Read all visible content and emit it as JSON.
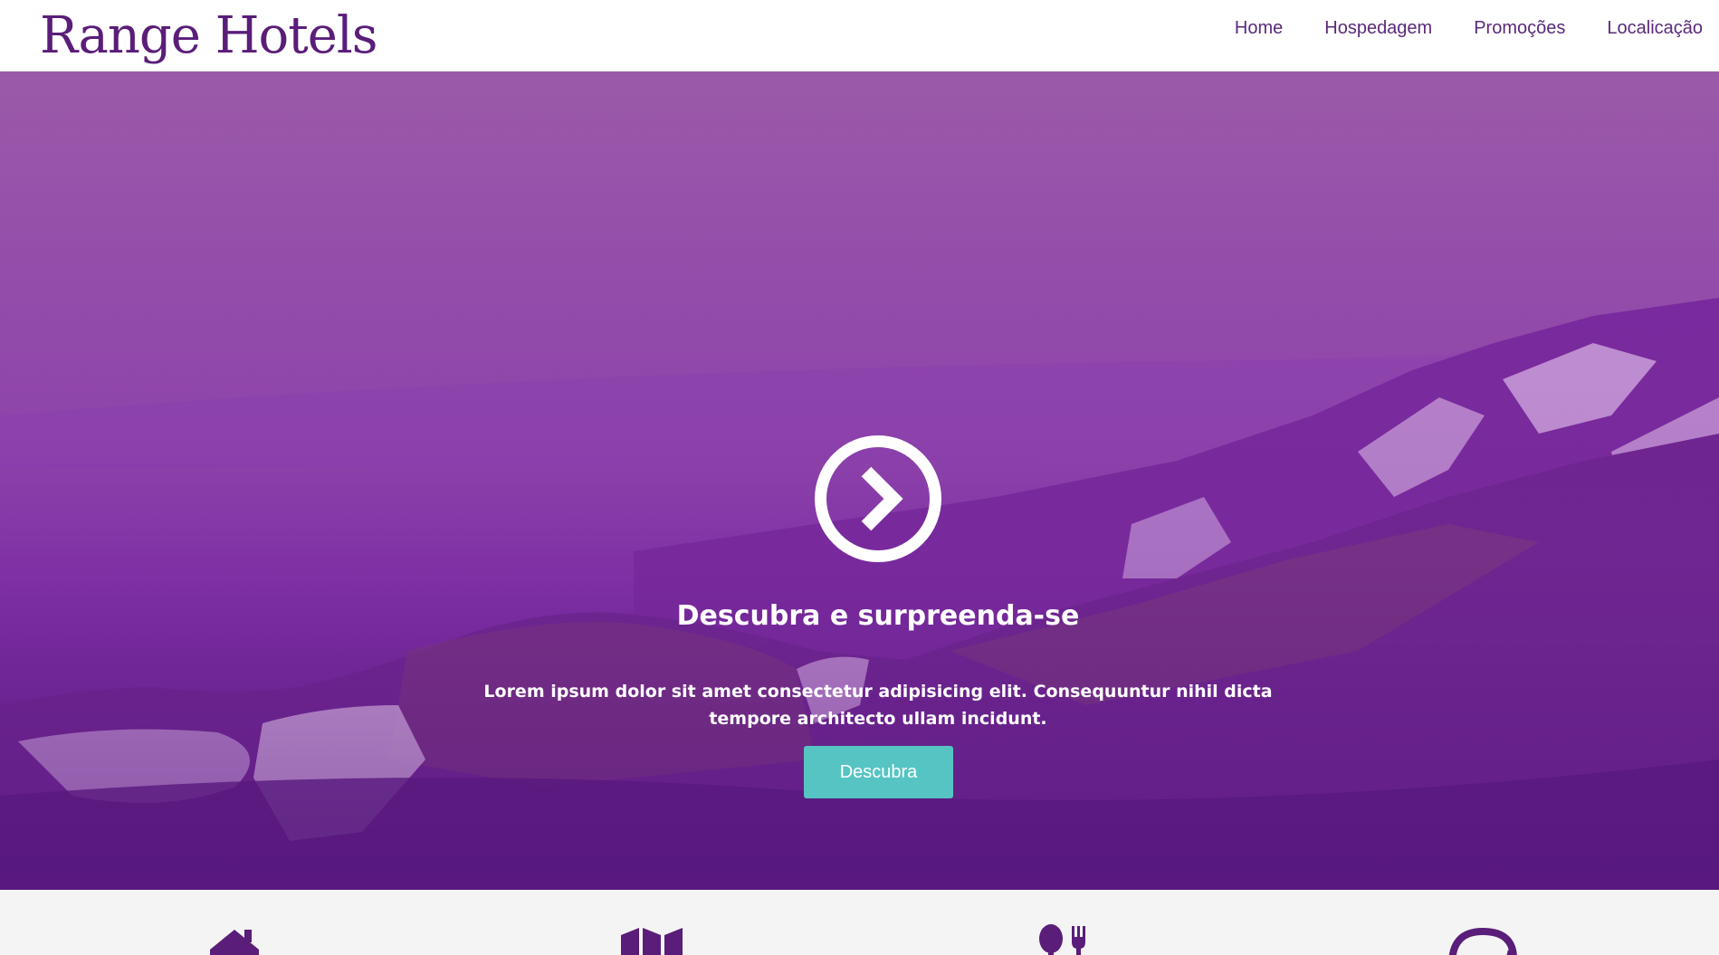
{
  "brand": {
    "logo_text": "Range Hotels",
    "color": "#5a1d79"
  },
  "nav": {
    "items": [
      {
        "label": "Home"
      },
      {
        "label": "Hospedagem"
      },
      {
        "label": "Promoções"
      },
      {
        "label": "Localicação"
      }
    ]
  },
  "hero": {
    "title": "Descubra e surpreenda-se",
    "text": "Lorem ipsum dolor sit amet consectetur adipisicing elit. Consequuntur nihil dicta tempore architecto ullam incidunt.",
    "button_label": "Descubra",
    "button_color": "#56c4c3",
    "overlay_color": "#8a3fb0",
    "play_icon": "chevron-right-circle-icon"
  },
  "features": {
    "icons": [
      "home-icon",
      "map-icon",
      "restaurant-icon",
      "chat-icon"
    ],
    "icon_color": "#5a1d79"
  }
}
